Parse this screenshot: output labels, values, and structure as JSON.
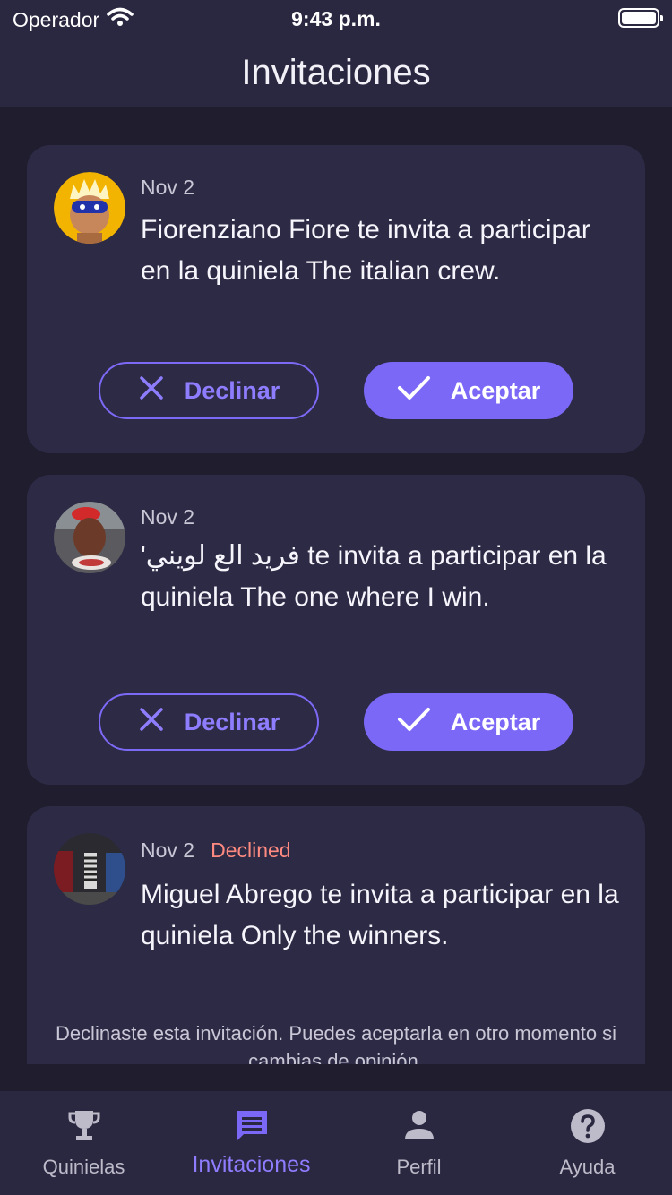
{
  "status_bar": {
    "carrier": "Operador",
    "time": "9:43 p.m."
  },
  "header": {
    "title": "Invitaciones"
  },
  "invitations": [
    {
      "date": "Nov 2",
      "status": "",
      "message": "Fiorenziano Fiore te invita a participar en la quiniela The italian crew.",
      "decline_label": "Declinar",
      "accept_label": "Aceptar"
    },
    {
      "date": "Nov 2",
      "status": "",
      "message": "'فريد الع لويني te invita a participar en la quiniela The one where I win.",
      "decline_label": "Declinar",
      "accept_label": "Aceptar"
    },
    {
      "date": "Nov 2",
      "status": "Declined",
      "message": "Miguel Abrego te invita a participar en la quiniela Only the winners.",
      "note": "Declinaste esta invitación. Puedes aceptarla en otro momento si cambias de opinión."
    }
  ],
  "tabs": [
    {
      "label": "Quinielas",
      "icon": "trophy-icon"
    },
    {
      "label": "Invitaciones",
      "icon": "chat-icon"
    },
    {
      "label": "Perfil",
      "icon": "person-icon"
    },
    {
      "label": "Ayuda",
      "icon": "help-icon"
    }
  ],
  "colors": {
    "accent": "#7b68f6",
    "background": "#1f1d2e",
    "card": "#2d2a45",
    "declined": "#ff8a80"
  }
}
